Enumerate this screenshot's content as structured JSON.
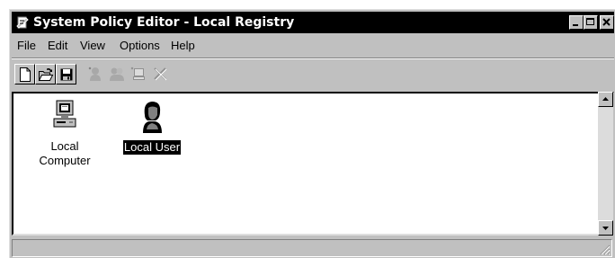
{
  "window": {
    "title": "System Policy Editor - Local Registry",
    "icon": "policy-editor-icon",
    "controls": [
      "minimize-icon",
      "maximize-icon",
      "close-icon"
    ]
  },
  "menu": [
    "File",
    "Edit",
    "View",
    "Options",
    "Help"
  ],
  "toolbar": {
    "buttons": [
      {
        "name": "new",
        "icon": "new-document-icon",
        "enabled": true
      },
      {
        "name": "open",
        "icon": "open-folder-icon",
        "enabled": true
      },
      {
        "name": "save",
        "icon": "save-disk-icon",
        "enabled": true
      },
      {
        "name": "add-user",
        "icon": "add-user-icon",
        "enabled": false
      },
      {
        "name": "add-group",
        "icon": "add-group-icon",
        "enabled": false
      },
      {
        "name": "add-computer",
        "icon": "add-computer-icon",
        "enabled": false
      },
      {
        "name": "remove",
        "icon": "remove-x-icon",
        "enabled": false
      }
    ]
  },
  "items": [
    {
      "label": "Local Computer",
      "icon": "computer-icon",
      "selected": false
    },
    {
      "label": "Local User",
      "icon": "user-icon",
      "selected": true
    }
  ],
  "colors": {
    "face": "#c0c0c0",
    "title_bg": "#000000",
    "selection": "#000000"
  }
}
